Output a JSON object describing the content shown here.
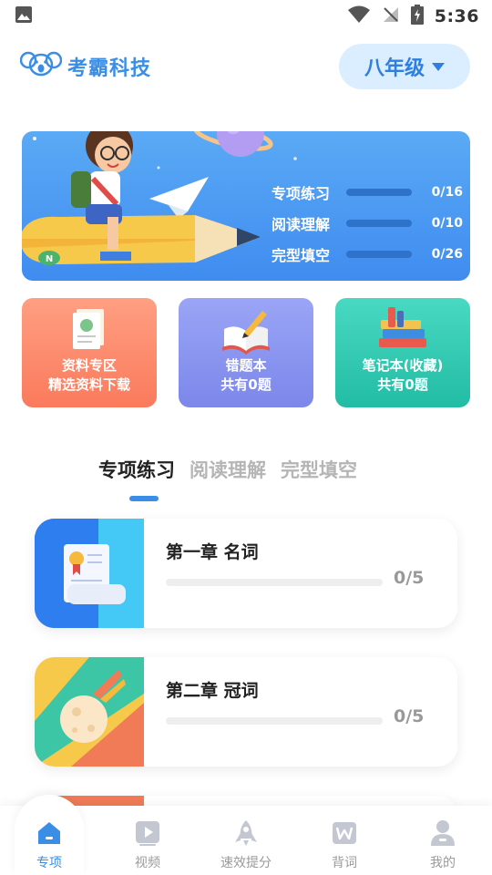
{
  "status_bar": {
    "time": "5:36"
  },
  "header": {
    "brand": "考霸科技",
    "grade": "八年级"
  },
  "banner": {
    "progress": [
      {
        "label": "专项练习",
        "value": "0/16",
        "fraction": 0
      },
      {
        "label": "阅读理解",
        "value": "0/10",
        "fraction": 0
      },
      {
        "label": "完型填空",
        "value": "0/26",
        "fraction": 0
      }
    ]
  },
  "features": [
    {
      "title": "资料专区",
      "subtitle": "精选资料下载",
      "icon": "document-icon"
    },
    {
      "title": "错题本",
      "subtitle": "共有0题",
      "icon": "notebook-pencil-icon"
    },
    {
      "title": "笔记本(收藏)",
      "subtitle": "共有0题",
      "icon": "books-icon"
    }
  ],
  "tabs": [
    {
      "label": "专项练习",
      "active": true
    },
    {
      "label": "阅读理解",
      "active": false
    },
    {
      "label": "完型填空",
      "active": false
    }
  ],
  "chapters": [
    {
      "title": "第一章  名词",
      "progress": "0/5",
      "fraction": 0
    },
    {
      "title": "第二章  冠词",
      "progress": "0/5",
      "fraction": 0
    }
  ],
  "nav": [
    {
      "label": "专项",
      "icon": "home-icon",
      "active": true
    },
    {
      "label": "视频",
      "icon": "video-icon",
      "active": false
    },
    {
      "label": "速效提分",
      "icon": "rocket-icon",
      "active": false
    },
    {
      "label": "背词",
      "icon": "word-book-icon",
      "active": false
    },
    {
      "label": "我的",
      "icon": "profile-icon",
      "active": false
    }
  ],
  "colors": {
    "accent": "#3a8ee6",
    "banner": "#4a98f2",
    "card_orange": "#fb7a5c",
    "card_purple": "#7c87ea",
    "card_teal": "#22bca4"
  }
}
